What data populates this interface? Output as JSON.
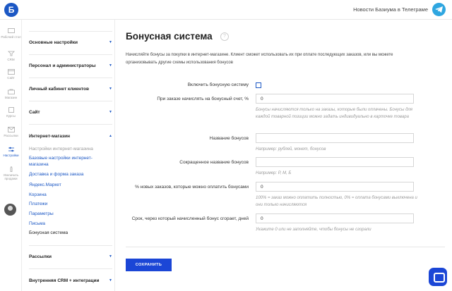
{
  "topbar": {
    "logo_letter": "Б",
    "news_link": "Новости Базиума в Телеграме"
  },
  "rail": {
    "items": [
      {
        "label": "Рабочий стол",
        "icon": "desktop-icon"
      },
      {
        "label": "CRM",
        "icon": "crm-icon"
      },
      {
        "label": "Сайт",
        "icon": "site-icon"
      },
      {
        "label": "Магазин",
        "icon": "shop-icon"
      },
      {
        "label": "Курсы",
        "icon": "courses-icon"
      },
      {
        "label": "Рассылки",
        "icon": "mail-icon"
      },
      {
        "label": "Настройки",
        "icon": "settings-icon"
      },
      {
        "label": "Увеличить продажи",
        "icon": "growth-icon"
      }
    ],
    "active": "Настройки"
  },
  "sidebar": {
    "sections": [
      {
        "label": "Основные настройки"
      },
      {
        "label": "Персонал и администраторы"
      },
      {
        "label": "Личный кабинет клиентов"
      },
      {
        "label": "Сайт"
      },
      {
        "label": "Интернет-магазин"
      },
      {
        "label": "Рассылки"
      },
      {
        "label": "Внутренняя CRM + интеграции"
      }
    ],
    "shop_items": [
      "Настройки интернет-магазина",
      "Базовые настройки интернет-магазина",
      "Доставка и форма заказа",
      "Яндекс.Маркет",
      "Корзина",
      "Платежи",
      "Параметры",
      "Письма",
      "Бонусная система"
    ]
  },
  "main": {
    "title": "Бонусная система",
    "help_glyph": "?",
    "intro": "Начисляйте бонусы за покупки в интернет-магазине. Клиент сможет использовать их при оплате последующих заказов, или вы можете организовывать другие схемы использования бонусов",
    "enable_label": "Включить бонусную систему",
    "enable_checked": false,
    "percent_label": "При заказе начислять на бонусный счет, %",
    "percent_value": "0",
    "percent_hint": "Бонусы начисляются только на заказы, которые были оплачены. Бонусы для каждой товарной позиции можно задать индивидуально в карточке товара",
    "name_label": "Название бонусов",
    "name_value": "",
    "name_hint": "Например: рублей, монет, бонусов",
    "short_label": "Сокращенное название бонусов",
    "short_value": "",
    "short_hint": "Например: Р, М, Б",
    "pay_label": "% новых заказов, которые можно оплатить бонусами",
    "pay_value": "0",
    "pay_hint": "100% = заказ можно оплатить полностью, 0% = оплата бонусами выключена и они только начисляются",
    "expire_label": "Срок, через который начисленный бонус сгорает, дней",
    "expire_value": "0",
    "expire_hint": "Укажите 0 или не заполняйте, чтобы бонусы не сгорали",
    "save_label": "СОХРАНИТЬ"
  },
  "colors": {
    "accent": "#1b46d6",
    "link": "#1b57c4",
    "telegram": "#2ea6e0"
  }
}
